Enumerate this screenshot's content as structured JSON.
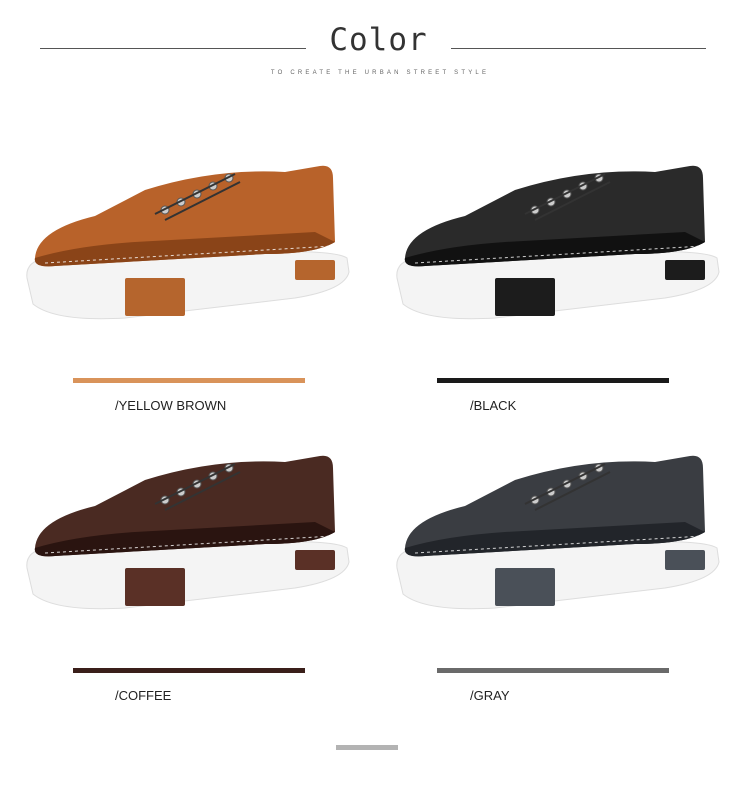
{
  "header": {
    "title": "Color",
    "subtitle": "TO CREATE THE URBAN STREET STYLE"
  },
  "variants": [
    {
      "label": "/YELLOW BROWN",
      "swatch": "#d9935a",
      "upper": "#b8622a",
      "upper_dark": "#8a4418",
      "accent": "#b5652d"
    },
    {
      "label": "/BLACK",
      "swatch": "#1a1a1a",
      "upper": "#2a2a2a",
      "upper_dark": "#111111",
      "accent": "#1c1c1c"
    },
    {
      "label": "/COFFEE",
      "swatch": "#3a1f1a",
      "upper": "#4a2a22",
      "upper_dark": "#2a1410",
      "accent": "#5a3026"
    },
    {
      "label": "/GRAY",
      "swatch": "#6a6a6a",
      "upper": "#3a3d42",
      "upper_dark": "#22252a",
      "accent": "#4a5058"
    }
  ],
  "footer": {
    "indicator_color": "#b3b3b3"
  }
}
